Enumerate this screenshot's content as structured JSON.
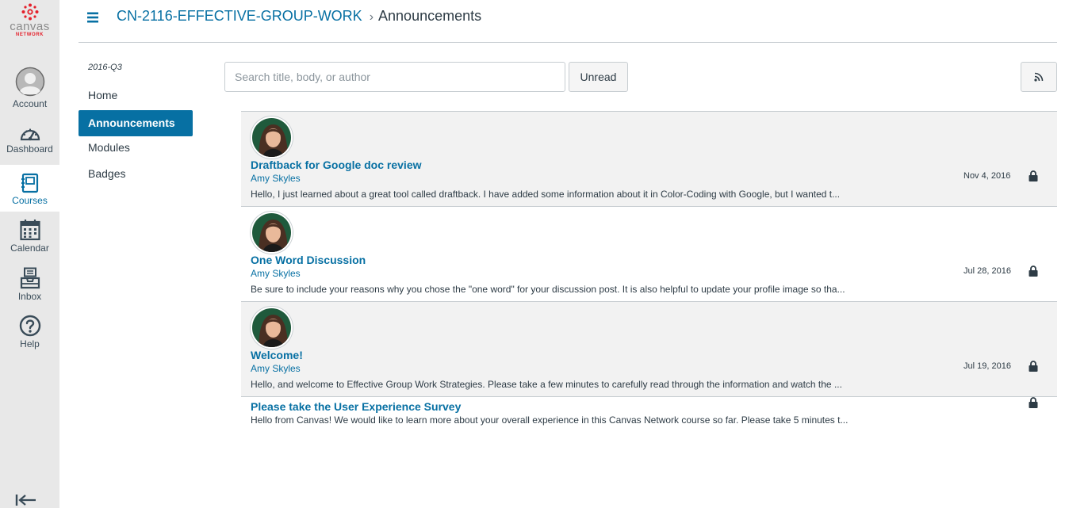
{
  "brand": {
    "name": "canvas",
    "sub": "NETWORK"
  },
  "global_nav": [
    {
      "label": "Account",
      "icon": "account-avatar-icon"
    },
    {
      "label": "Dashboard",
      "icon": "dashboard-icon"
    },
    {
      "label": "Courses",
      "icon": "courses-icon",
      "active": true
    },
    {
      "label": "Calendar",
      "icon": "calendar-icon"
    },
    {
      "label": "Inbox",
      "icon": "inbox-icon"
    },
    {
      "label": "Help",
      "icon": "help-icon"
    }
  ],
  "header": {
    "course": "CN-2116-EFFECTIVE-GROUP-WORK",
    "separator": "›",
    "current": "Announcements"
  },
  "course_nav": {
    "term": "2016-Q3",
    "items": [
      {
        "label": "Home"
      },
      {
        "label": "Announcements",
        "active": true
      },
      {
        "label": "Modules"
      },
      {
        "label": "Badges"
      }
    ]
  },
  "toolbar": {
    "search_placeholder": "Search title, body, or author",
    "search_value": "",
    "unread_label": "Unread",
    "rss_icon": "rss-icon"
  },
  "announcements": [
    {
      "title": "Draftback for Google doc review",
      "author": "Amy Skyles",
      "message": "Hello, I just learned about a great tool called draftback. I have added some information about it in Color-Coding with Google, but I wanted t...",
      "date": "Nov 4, 2016",
      "locked": true
    },
    {
      "title": "One Word Discussion",
      "author": "Amy Skyles",
      "message": "Be sure to include your reasons why you chose the \"one word\" for your discussion post. It is also helpful to update your profile image so tha...",
      "date": "Jul 28, 2016",
      "locked": true
    },
    {
      "title": "Welcome!",
      "author": "Amy Skyles",
      "message": "Hello, and welcome to Effective Group Work Strategies. Please take a few minutes to carefully read through the information and watch the ...",
      "date": "Jul 19, 2016",
      "locked": true
    },
    {
      "title": "Please take the User Experience Survey",
      "message": "Hello from Canvas! We would like to learn more about your overall experience in this Canvas Network course so far. Please take 5 minutes t...",
      "locked": true
    }
  ],
  "colors": {
    "link": "#0770a3",
    "nav_bg": "#e8e8e8",
    "active_bg": "#0770a3",
    "brand_red": "#e4202b"
  }
}
